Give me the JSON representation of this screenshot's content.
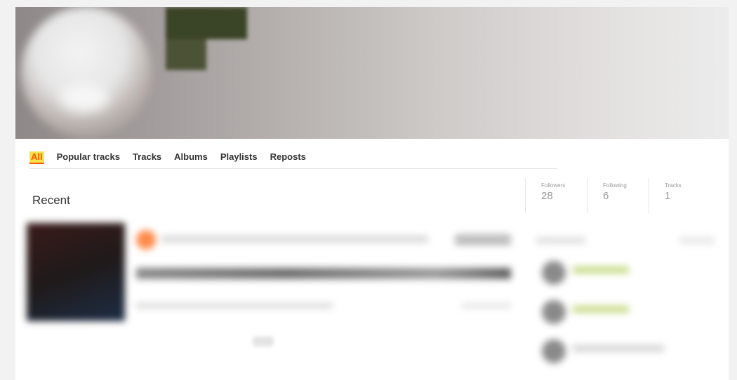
{
  "profile": {
    "banner_colors": {
      "left": "#8e8888",
      "right": "#ececec"
    },
    "avatar_icon": "user-avatar-blurred"
  },
  "tabs": [
    {
      "label": "All",
      "active": true
    },
    {
      "label": "Popular tracks",
      "active": false
    },
    {
      "label": "Tracks",
      "active": false
    },
    {
      "label": "Albums",
      "active": false
    },
    {
      "label": "Playlists",
      "active": false
    },
    {
      "label": "Reposts",
      "active": false
    }
  ],
  "main": {
    "section_title": "Recent"
  },
  "stats": [
    {
      "label": "Followers",
      "value": "28"
    },
    {
      "label": "Following",
      "value": "6"
    },
    {
      "label": "Tracks",
      "value": "1"
    }
  ],
  "colors": {
    "accent": "#ff5500",
    "active_tab_highlight": "#f7e24c"
  }
}
